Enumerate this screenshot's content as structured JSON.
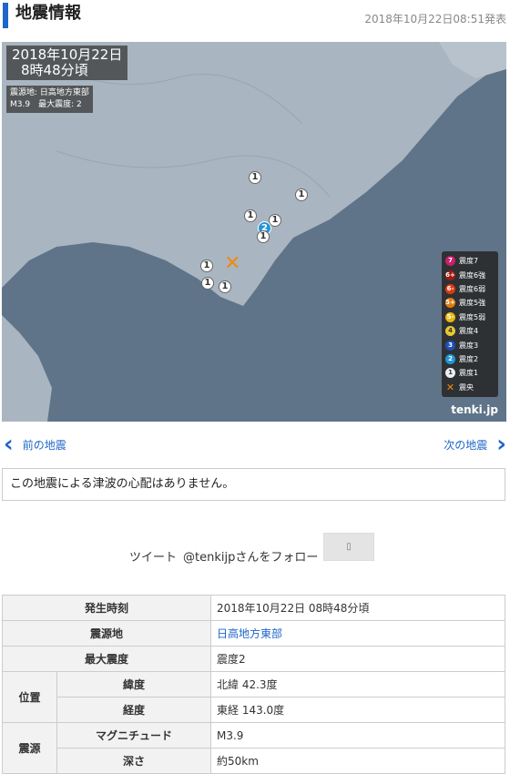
{
  "header": {
    "title": "地震情報",
    "posted": "2018年10月22日08:51発表"
  },
  "map": {
    "stamp_date": "2018年10月22日",
    "stamp_time": "8時48分頃",
    "epicenter_label": "震源地: 日高地方東部",
    "magnitude_label": "M3.9　最大震度: 2",
    "brand": "tenki.jp",
    "markers": [
      "1",
      "1",
      "1",
      "1",
      "2",
      "1",
      "1",
      "1",
      "1"
    ],
    "legend": [
      {
        "label": "震度7",
        "icon": "7",
        "color": "#c8206a"
      },
      {
        "label": "震度6強",
        "icon": "6+",
        "color": "#a01a10"
      },
      {
        "label": "震度6弱",
        "icon": "6-",
        "color": "#e03a10"
      },
      {
        "label": "震度5強",
        "icon": "5+",
        "color": "#e07a10"
      },
      {
        "label": "震度5弱",
        "icon": "5-",
        "color": "#e8b810"
      },
      {
        "label": "震度4",
        "icon": "4",
        "color": "#e8c830"
      },
      {
        "label": "震度3",
        "icon": "3",
        "color": "#1e50b8"
      },
      {
        "label": "震度2",
        "icon": "2",
        "color": "#2196d8"
      },
      {
        "label": "震度1",
        "icon": "1",
        "color": "#eeeeee"
      },
      {
        "label": "震央",
        "icon": "✕",
        "color": "#f08a14"
      }
    ]
  },
  "nav": {
    "prev": "前の地震",
    "next": "次の地震"
  },
  "tsunami_notice": "この地震による津波の心配はありません。",
  "social": {
    "tweet": "ツイート",
    "follow": "@tenkijpさんをフォロー"
  },
  "table": {
    "occurred_label": "発生時刻",
    "occurred_value": "2018年10月22日 08時48分頃",
    "epicenter_label": "震源地",
    "epicenter_value": "日高地方東部",
    "max_intensity_label": "最大震度",
    "max_intensity_value": "震度2",
    "position_label": "位置",
    "lat_label": "緯度",
    "lat_value": "北緯 42.3度",
    "lon_label": "経度",
    "lon_value": "東経 143.0度",
    "source_label": "震源",
    "mag_label": "マグニチュード",
    "mag_value": "M3.9",
    "depth_label": "深さ",
    "depth_value": "約50km"
  }
}
